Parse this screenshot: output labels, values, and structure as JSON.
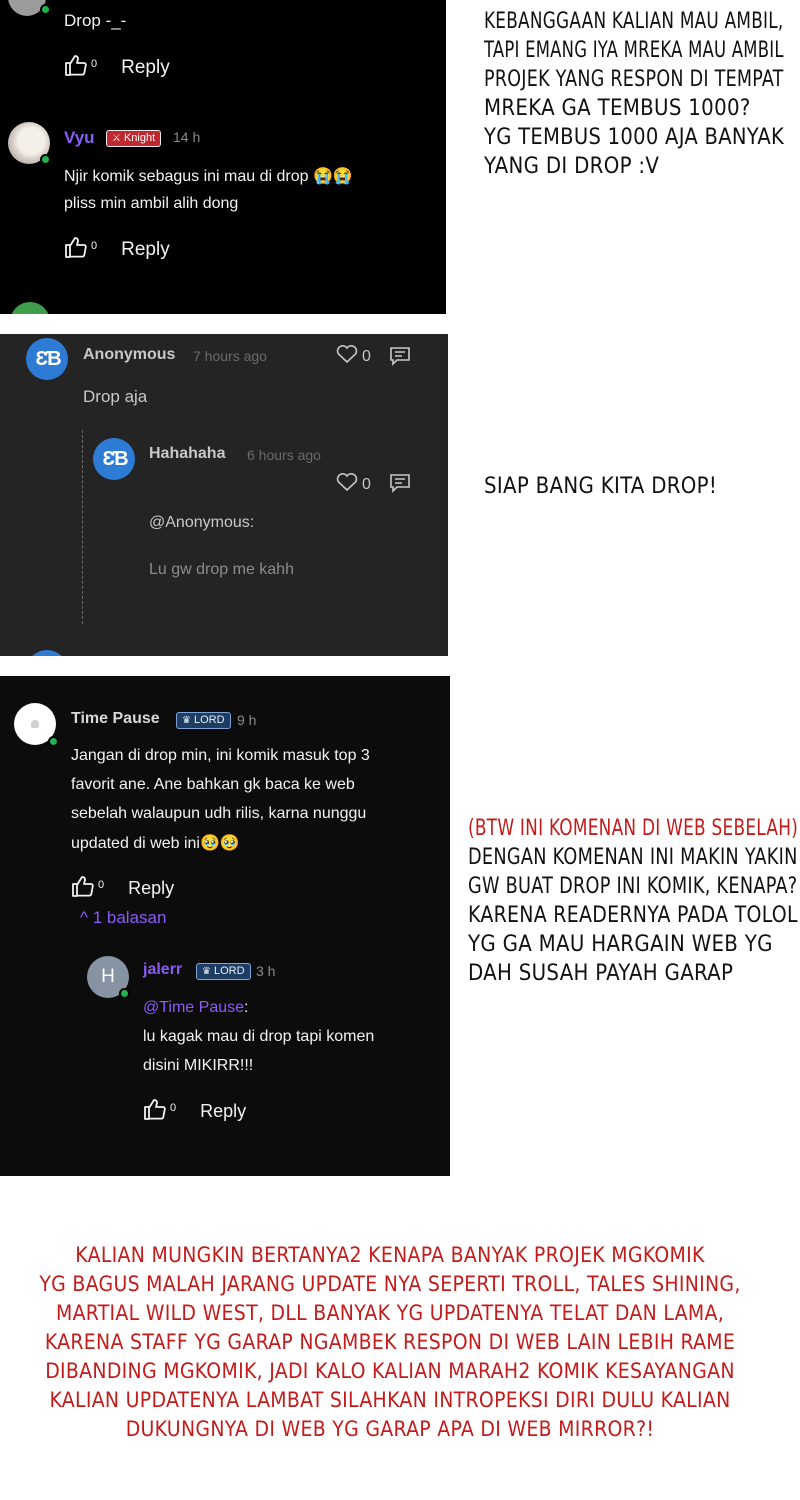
{
  "panel1": {
    "comment0_text": "Drop -_-",
    "comment0_likes": "0",
    "reply_label": "Reply",
    "comment1": {
      "author": "Vyu",
      "badge": "Knight",
      "time": "14 h",
      "line1": "Njir komik sebagus ini mau di drop 😭😭",
      "line2": "pliss min ambil alih dong",
      "likes": "0"
    }
  },
  "panel2": {
    "comment": {
      "author": "Anonymous",
      "time": "7 hours ago",
      "likes": "0",
      "text": "Drop aja"
    },
    "reply": {
      "author": "Hahahaha",
      "time": "6 hours ago",
      "likes": "0",
      "mention": "@Anonymous:",
      "text": "Lu gw drop me kahh"
    }
  },
  "panel3": {
    "comment": {
      "avatar_letter": "",
      "author": "Time Pause",
      "badge": "LORD",
      "time": "9 h",
      "lines": [
        "Jangan di drop min, ini komik masuk top 3",
        "favorit ane. Ane bahkan gk baca ke web",
        "sebelah walaupun udh rilis, karna nunggu",
        "updated di web ini🥹🥹"
      ],
      "likes": "0",
      "reply_label": "Reply",
      "replies_toggle": "^ 1 balasan"
    },
    "reply": {
      "avatar_letter": "H",
      "author": "jalerr",
      "badge": "LORD",
      "time": "3 h",
      "mention": "@Time Pause",
      "mention_suffix": ":",
      "lines": [
        "lu kagak mau di drop tapi komen",
        "disini MIKIRR!!!"
      ],
      "likes": "0",
      "reply_label": "Reply"
    }
  },
  "captions": {
    "top": [
      "KEBANGGAAN KALIAN MAU AMBIL,",
      "TAPI EMANG IYA MREKA MAU AMBIL",
      "PROJEK YANG RESPON DI TEMPAT",
      "MREKA GA TEMBUS 1000?",
      "YG TEMBUS 1000 AJA BANYAK",
      "YANG DI DROP :V"
    ],
    "middle": "SIAP BANG KITA DROP!",
    "bottom_right": [
      "(BTW INI KOMENAN DI WEB SEBELAH)",
      "DENGAN KOMENAN INI MAKIN YAKIN",
      "GW BUAT DROP INI KOMIK, KENAPA?",
      "KARENA READERNYA PADA TOLOL",
      "YG GA MAU HARGAIN WEB YG",
      "DAH SUSAH PAYAH GARAP"
    ],
    "footer": [
      "KALIAN MUNGKIN BERTANYA2 KENAPA BANYAK PROJEK MGKOMIK",
      "YG BAGUS MALAH JARANG UPDATE NYA SEPERTI TROLL, TALES SHINING,",
      "MARTIAL WILD WEST, DLL BANYAK YG UPDATENYA TELAT DAN LAMA,",
      "KARENA STAFF YG GARAP NGAMBEK RESPON DI WEB LAIN LEBIH RAME",
      "DIBANDING MGKOMIK, JADI KALO KALIAN MARAH2 KOMIK KESAYANGAN",
      "KALIAN UPDATENYA LAMBAT SILAHKAN INTROPEKSI DIRI DULU KALIAN",
      "DUKUNGNYA DI WEB YG GARAP APA DI WEB MIRROR?!"
    ]
  },
  "colors": {
    "vyu_name": "#8a5cf6",
    "jalerr_name": "#8a5cf6",
    "mention": "#8a5cf6",
    "replies_toggle": "#8a5cf6",
    "footer_text": "#c41b1b"
  }
}
